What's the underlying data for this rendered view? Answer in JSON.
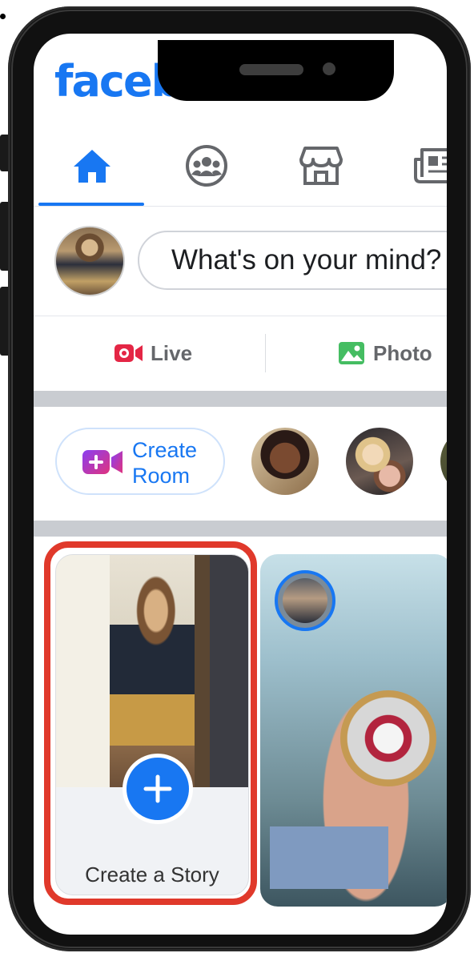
{
  "app": {
    "logo": "facebook",
    "accent_color": "#1877f2"
  },
  "tabs": [
    {
      "name": "home",
      "icon": "home-icon",
      "active": true
    },
    {
      "name": "groups",
      "icon": "groups-icon",
      "active": false
    },
    {
      "name": "marketplace",
      "icon": "marketplace-icon",
      "active": false
    },
    {
      "name": "news",
      "icon": "news-icon",
      "active": false
    }
  ],
  "composer": {
    "placeholder": "What's on your mind?"
  },
  "actions": {
    "live_label": "Live",
    "photo_label": "Photo"
  },
  "rooms": {
    "create_room_label": "Create Room"
  },
  "stories": {
    "create_story_label": "Create a Story",
    "highlight_color": "#e0392b"
  }
}
